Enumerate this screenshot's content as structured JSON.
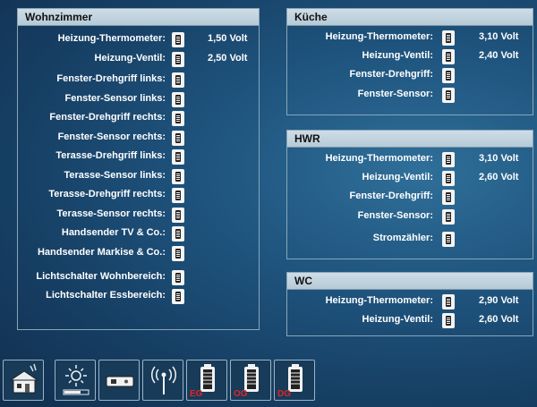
{
  "panels": {
    "wohnzimmer": {
      "title": "Wohnzimmer",
      "rows": [
        {
          "label": "Heizung-Thermometer:",
          "value": "1,50 Volt"
        },
        {
          "label": "Heizung-Ventil:",
          "value": "2,50 Volt"
        },
        {
          "label": "Fenster-Drehgriff links:",
          "value": ""
        },
        {
          "label": "Fenster-Sensor links:",
          "value": ""
        },
        {
          "label": "Fenster-Drehgriff rechts:",
          "value": ""
        },
        {
          "label": "Fenster-Sensor rechts:",
          "value": ""
        },
        {
          "label": "Terasse-Drehgriff links:",
          "value": ""
        },
        {
          "label": "Terasse-Sensor links:",
          "value": ""
        },
        {
          "label": "Terasse-Drehgriff rechts:",
          "value": ""
        },
        {
          "label": "Terasse-Sensor rechts:",
          "value": ""
        },
        {
          "label": "Handsender TV & Co.:",
          "value": ""
        },
        {
          "label": "Handsender Markise & Co.:",
          "value": ""
        },
        {
          "label": "Lichtschalter Wohnbereich:",
          "value": ""
        },
        {
          "label": "Lichtschalter Essbereich:",
          "value": ""
        }
      ]
    },
    "kueche": {
      "title": "Küche",
      "rows": [
        {
          "label": "Heizung-Thermometer:",
          "value": "3,10 Volt"
        },
        {
          "label": "Heizung-Ventil:",
          "value": "2,40 Volt"
        },
        {
          "label": "Fenster-Drehgriff:",
          "value": ""
        },
        {
          "label": "Fenster-Sensor:",
          "value": ""
        }
      ]
    },
    "hwr": {
      "title": "HWR",
      "rows": [
        {
          "label": "Heizung-Thermometer:",
          "value": "3,10 Volt"
        },
        {
          "label": "Heizung-Ventil:",
          "value": "2,60 Volt"
        },
        {
          "label": "Fenster-Drehgriff:",
          "value": ""
        },
        {
          "label": "Fenster-Sensor:",
          "value": ""
        },
        {
          "label": "Stromzähler:",
          "value": ""
        }
      ]
    },
    "wc": {
      "title": "WC",
      "rows": [
        {
          "label": "Heizung-Thermometer:",
          "value": "2,90 Volt"
        },
        {
          "label": "Heizung-Ventil:",
          "value": "2,60 Volt"
        }
      ]
    }
  },
  "dock": {
    "buttons": [
      {
        "icon": "house-icon",
        "label": ""
      },
      {
        "icon": "brightness-icon",
        "label": ""
      },
      {
        "icon": "remote-icon",
        "label": ""
      },
      {
        "icon": "antenna-icon",
        "label": ""
      },
      {
        "icon": "battery-icon",
        "label": "EG"
      },
      {
        "icon": "battery-icon",
        "label": "OG"
      },
      {
        "icon": "battery-icon",
        "label": "DG"
      }
    ]
  },
  "colors": {
    "floor_label": "#e0252c",
    "panel_header": "#c3d4df"
  }
}
